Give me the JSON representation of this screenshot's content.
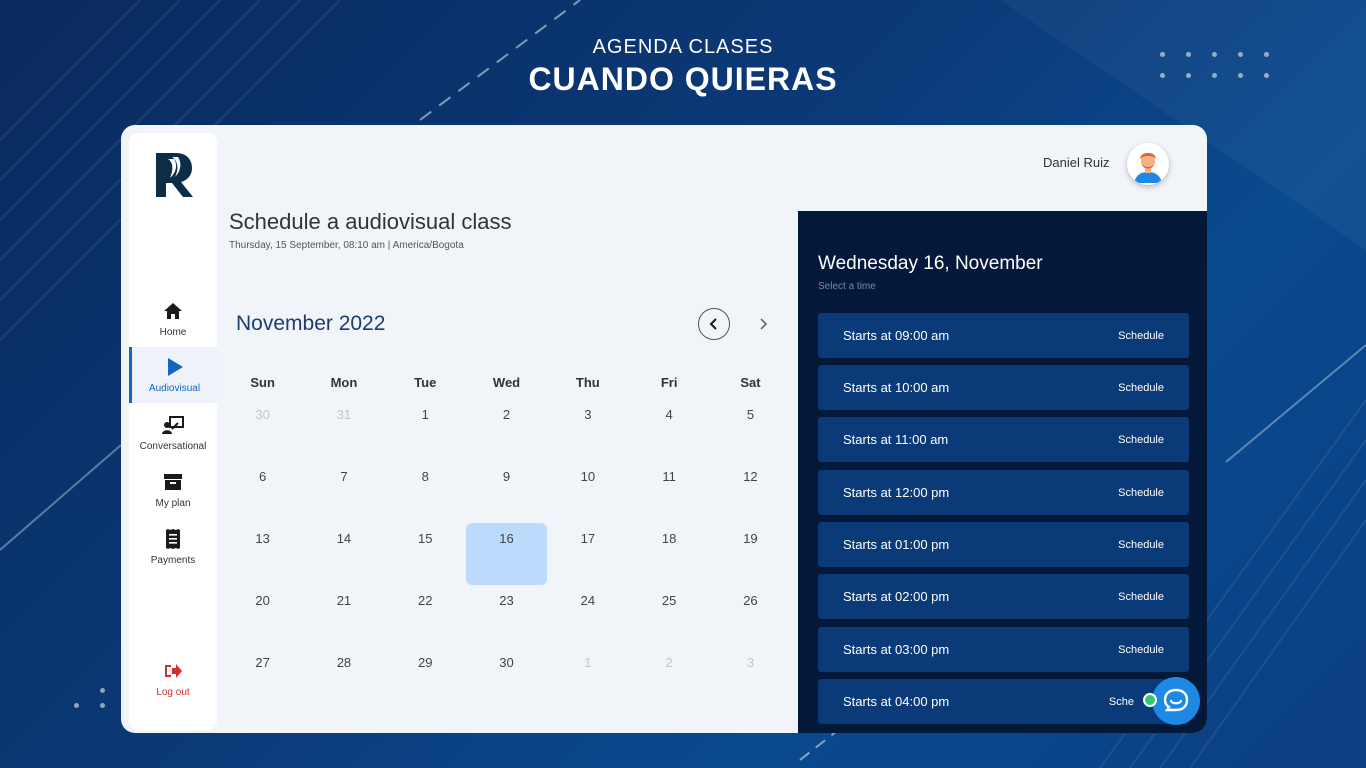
{
  "promo": {
    "subtitle": "AGENDA CLASES",
    "title": "CUANDO QUIERAS"
  },
  "user": {
    "name": "Daniel Ruiz"
  },
  "sidebar": {
    "items": [
      {
        "label": "Home",
        "icon": "home-icon"
      },
      {
        "label": "Audiovisual",
        "icon": "play-icon",
        "active": true
      },
      {
        "label": "Conversational",
        "icon": "chat-board-icon"
      },
      {
        "label": "My plan",
        "icon": "archive-icon"
      },
      {
        "label": "Payments",
        "icon": "receipt-icon"
      }
    ],
    "logout": "Log out"
  },
  "page": {
    "title": "Schedule a audiovisual class",
    "subtitle": "Thursday, 15 September, 08:10 am | America/Bogota"
  },
  "calendar": {
    "month": "November 2022",
    "weekdays": [
      "Sun",
      "Mon",
      "Tue",
      "Wed",
      "Thu",
      "Fri",
      "Sat"
    ],
    "weeks": [
      [
        "30",
        "31",
        "1",
        "2",
        "3",
        "4",
        "5"
      ],
      [
        "6",
        "7",
        "8",
        "9",
        "10",
        "11",
        "12"
      ],
      [
        "13",
        "14",
        "15",
        "16",
        "17",
        "18",
        "19"
      ],
      [
        "20",
        "21",
        "22",
        "23",
        "24",
        "25",
        "26"
      ],
      [
        "27",
        "28",
        "29",
        "30",
        "1",
        "2",
        "3"
      ]
    ],
    "selected_day": "16"
  },
  "panel": {
    "title": "Wednesday 16, November",
    "subtitle": "Select a time",
    "slots": [
      {
        "time": "Starts at 09:00 am",
        "action": "Schedule"
      },
      {
        "time": "Starts at 10:00 am",
        "action": "Schedule"
      },
      {
        "time": "Starts at 11:00 am",
        "action": "Schedule"
      },
      {
        "time": "Starts at 12:00 pm",
        "action": "Schedule"
      },
      {
        "time": "Starts at 01:00 pm",
        "action": "Schedule"
      },
      {
        "time": "Starts at 02:00 pm",
        "action": "Schedule"
      },
      {
        "time": "Starts at 03:00 pm",
        "action": "Schedule"
      },
      {
        "time": "Starts at 04:00 pm",
        "action": "Sche"
      }
    ]
  },
  "colors": {
    "accent": "#1565c0",
    "panel_bg": "#04183a",
    "slot_bg": "#0b3a78",
    "selected_day": "#bbdafc",
    "logout": "#d32f2f"
  }
}
